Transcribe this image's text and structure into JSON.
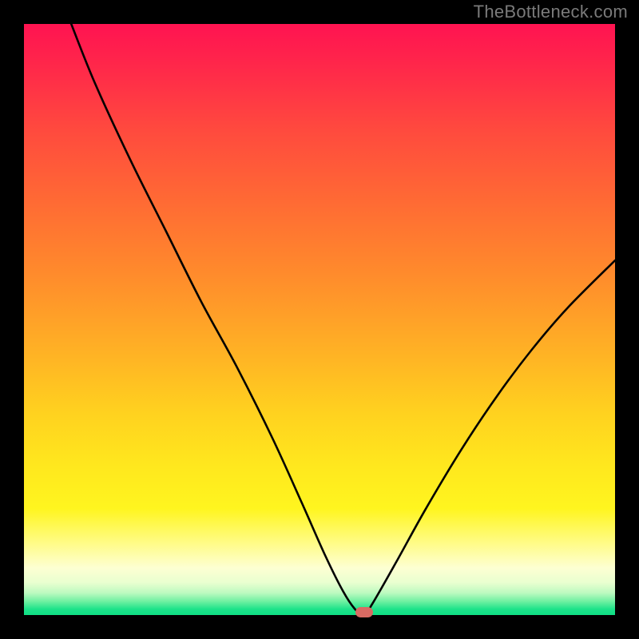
{
  "watermark": "TheBottleneck.com",
  "colors": {
    "frame_bg": "#000000",
    "marker": "#d96a63",
    "curve_stroke": "#000000",
    "gradient_top": "#ff1351",
    "gradient_bottom": "#10df85"
  },
  "chart_data": {
    "type": "line",
    "title": "",
    "xlabel": "",
    "ylabel": "",
    "xlim": [
      0,
      100
    ],
    "ylim": [
      0,
      100
    ],
    "series": [
      {
        "name": "bottleneck-curve",
        "x": [
          8,
          12,
          18,
          24,
          30,
          36,
          42,
          47,
          51,
          54,
          56,
          57.5,
          59,
          63,
          68,
          74,
          80,
          86,
          92,
          100
        ],
        "values": [
          100,
          90,
          77,
          65,
          53,
          42,
          30,
          19,
          10,
          4,
          1,
          0,
          2,
          9,
          18,
          28,
          37,
          45,
          52,
          60
        ]
      }
    ],
    "marker": {
      "x": 57.5,
      "y": 0
    },
    "annotations": []
  }
}
